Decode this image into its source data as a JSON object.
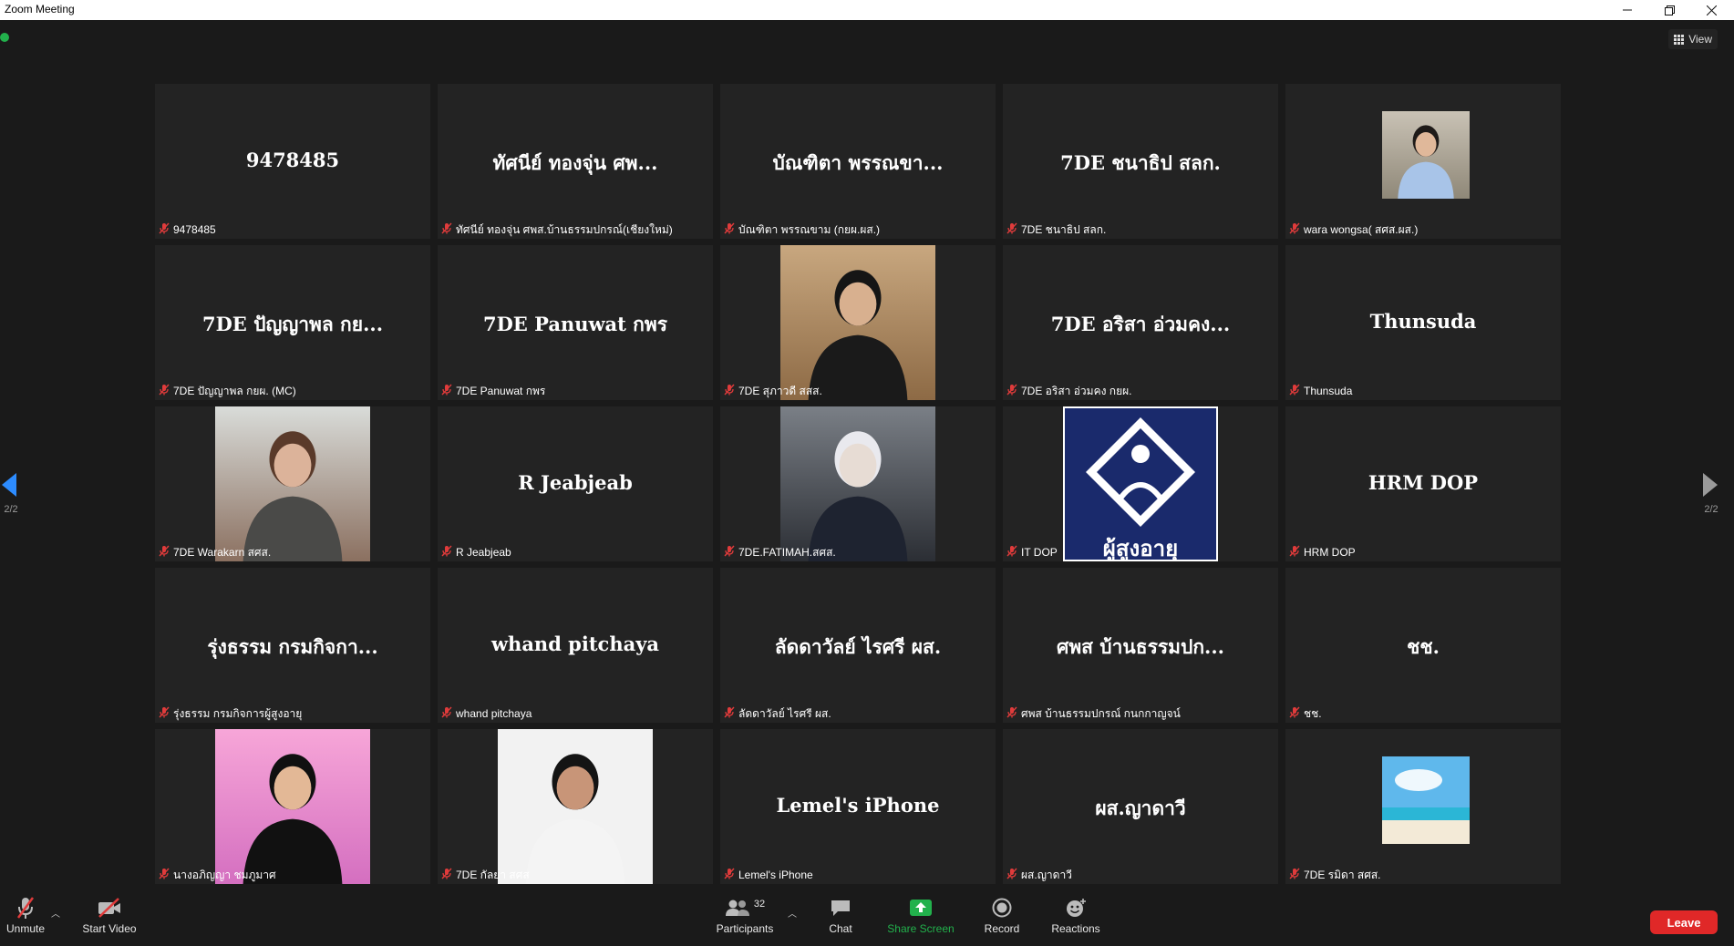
{
  "window": {
    "title": "Zoom Meeting"
  },
  "top": {
    "view_label": "View"
  },
  "pager": {
    "left": "2/2",
    "right": "2/2"
  },
  "tiles": [
    {
      "big": "9478485",
      "label": "9478485"
    },
    {
      "big": "ทัศนีย์ ทองจุ่น ศพ...",
      "label": "ทัศนีย์ ทองจุ่น ศพส.บ้านธรรมปกรณ์(เชียงใหม่)"
    },
    {
      "big": "บัณฑิตา พรรณขา...",
      "label": "บัณฑิตา พรรณขาม (กยผ.ผส.)"
    },
    {
      "big": "7DE ชนาธิป สลก.",
      "label": "7DE ชนาธิป สลก."
    },
    {
      "big": "",
      "label": "wara wongsa( สศส.ผส.)"
    },
    {
      "big": "7DE ปัญญาพล กย...",
      "label": "7DE ปัญญาพล กยผ. (MC)"
    },
    {
      "big": "7DE Panuwat กพร",
      "label": "7DE Panuwat กพร"
    },
    {
      "big": "",
      "label": "7DE สุภาวดี สสส."
    },
    {
      "big": "7DE อริสา อ่วมคง...",
      "label": "7DE อริสา อ่วมคง กยผ."
    },
    {
      "big": "Thunsuda",
      "label": "Thunsuda"
    },
    {
      "big": "",
      "label": "7DE Warakarn สศส."
    },
    {
      "big": "R Jeabjeab",
      "label": "R Jeabjeab"
    },
    {
      "big": "",
      "label": "7DE.FATIMAH.สศส."
    },
    {
      "big": "",
      "label": "IT DOP"
    },
    {
      "big": "HRM DOP",
      "label": "HRM DOP"
    },
    {
      "big": "รุ่งธรรม กรมกิจกา...",
      "label": "รุ่งธรรม กรมกิจการผู้สูงอายุ"
    },
    {
      "big": "whand pitchaya",
      "label": "whand pitchaya"
    },
    {
      "big": "ลัดดาวัลย์ ไรศรี ผส.",
      "label": "ลัดดาวัลย์ ไรศรี ผส."
    },
    {
      "big": "ศพส บ้านธรรมปก...",
      "label": "ศพส บ้านธรรมปกรณ์ กนกกาญจน์"
    },
    {
      "big": "ชช.",
      "label": "ชช."
    },
    {
      "big": "",
      "label": "นางอภิญญา ชมภูมาศ"
    },
    {
      "big": "",
      "label": "7DE กัลยา สศส"
    },
    {
      "big": "Lemel's iPhone",
      "label": "Lemel's iPhone"
    },
    {
      "big": "ผส.ญาดาวี",
      "label": "ผส.ญาดาวี"
    },
    {
      "big": "",
      "label": "7DE รมิดา สศส."
    }
  ],
  "logo_text": "ผู้สูงอายุ",
  "toolbar": {
    "unmute": "Unmute",
    "start_video": "Start Video",
    "participants": "Participants",
    "participants_count": "32",
    "chat": "Chat",
    "share_screen": "Share Screen",
    "record": "Record",
    "reactions": "Reactions",
    "leave": "Leave"
  },
  "colors": {
    "share": "#22b14c",
    "leave": "#e02828",
    "tile": "#232323",
    "muted": "#e03b3b"
  }
}
